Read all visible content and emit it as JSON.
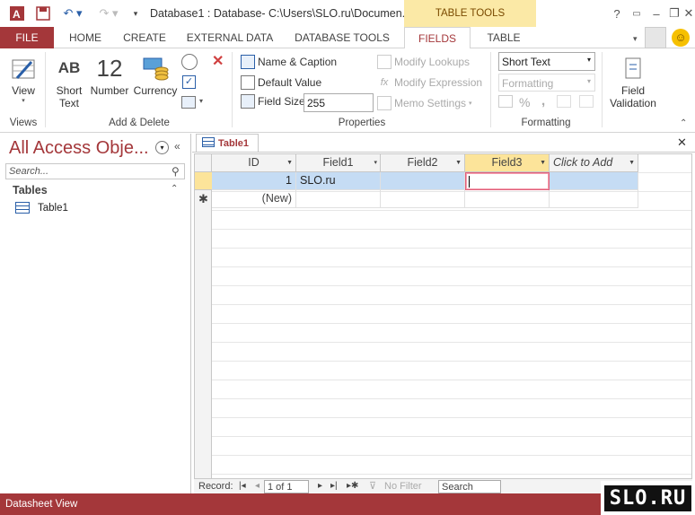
{
  "window": {
    "title": "Database1 : Database- C:\\Users\\SLO.ru\\Documen...",
    "context_group": "TABLE TOOLS",
    "minimize": "–",
    "restore": "❐",
    "close": "✕",
    "help": "?"
  },
  "tabs": [
    "FILE",
    "HOME",
    "CREATE",
    "EXTERNAL DATA",
    "DATABASE TOOLS",
    "FIELDS",
    "TABLE"
  ],
  "ribbon": {
    "views": {
      "view_label": "View",
      "group": "Views"
    },
    "add_delete": {
      "short_text_l1": "Short",
      "short_text_l2": "Text",
      "number_glyph": "12",
      "number_label": "Number",
      "currency_label": "Currency",
      "ab_glyph": "AB",
      "group": "Add & Delete"
    },
    "properties": {
      "name_caption": "Name & Caption",
      "default_value": "Default Value",
      "field_size_label": "Field Size",
      "field_size_value": "255",
      "modify_lookups": "Modify Lookups",
      "modify_expression": "Modify Expression",
      "memo_settings": "Memo Settings",
      "group": "Properties"
    },
    "formatting": {
      "data_type": "Short Text",
      "format": "Formatting",
      "percent": "%",
      "comma": ",",
      "group": "Formatting"
    },
    "validation": {
      "label_l1": "Field",
      "label_l2": "Validation"
    }
  },
  "nav": {
    "title": "All Access Obje...",
    "search_placeholder": "Search...",
    "section": "Tables",
    "items": [
      "Table1"
    ]
  },
  "doc_tab": "Table1",
  "datasheet": {
    "columns": [
      "ID",
      "Field1",
      "Field2",
      "Field3",
      "Click to Add"
    ],
    "rows": [
      {
        "id": "1",
        "field1": "SLO.ru",
        "field2": "",
        "field3": ""
      }
    ],
    "new_row_label": "(New)"
  },
  "record_nav": {
    "record_label": "Record:",
    "position": "1 of 1",
    "no_filter": "No Filter",
    "search": "Search"
  },
  "status": {
    "text": "Datasheet View"
  },
  "watermark": {
    "text": "SLO.RU"
  }
}
